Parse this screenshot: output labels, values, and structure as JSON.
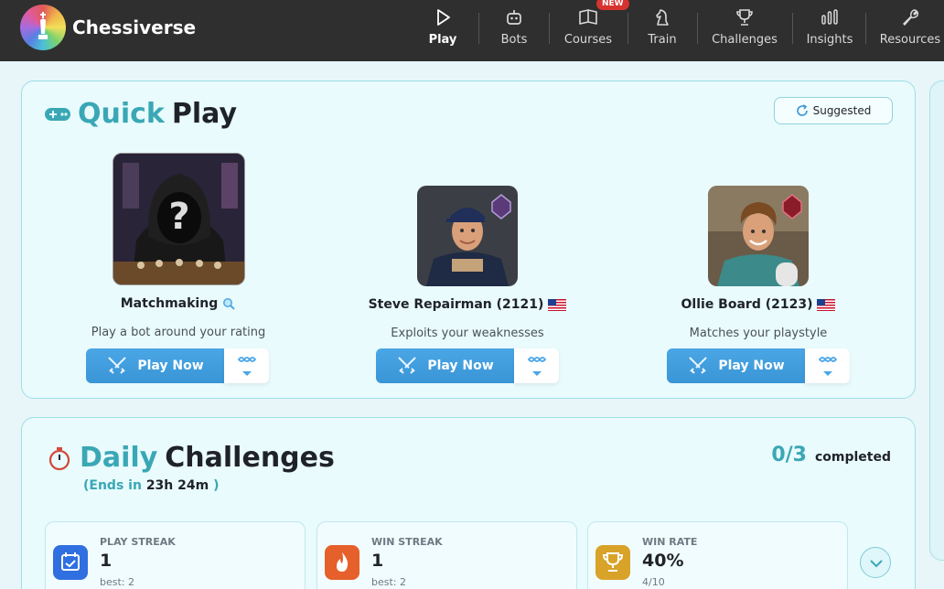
{
  "app": {
    "name": "Chessiverse"
  },
  "nav": {
    "items": [
      {
        "label": "Play",
        "icon": "play-icon",
        "active": true
      },
      {
        "label": "Bots",
        "icon": "robot-icon"
      },
      {
        "label": "Courses",
        "icon": "book-icon",
        "badge": "NEW"
      },
      {
        "label": "Train",
        "icon": "knight-icon"
      },
      {
        "label": "Challenges",
        "icon": "trophy-icon"
      },
      {
        "label": "Insights",
        "icon": "bar-chart-icon"
      },
      {
        "label": "Resources",
        "icon": "wrench-icon"
      }
    ]
  },
  "quick_play": {
    "title_accent": "Quick",
    "title_rest": "Play",
    "suggested_label": "Suggested",
    "bots": [
      {
        "name": "Matchmaking",
        "description": "Play a bot around your rating",
        "button": "Play Now"
      },
      {
        "name": "Steve Repairman (2121)",
        "description": "Exploits your weaknesses",
        "button": "Play Now"
      },
      {
        "name": "Ollie Board (2123)",
        "description": "Matches your playstyle",
        "button": "Play Now"
      }
    ]
  },
  "daily_challenges": {
    "title_accent": "Daily",
    "title_rest": "Challenges",
    "ends_label": "(Ends in",
    "ends_time": "23h 24m",
    "ends_close": ")",
    "completed_count": "0/3",
    "completed_label": "completed",
    "stats": [
      {
        "label": "PLAY STREAK",
        "value": "1",
        "best": "best: 2",
        "icon": "calendar-check-icon",
        "color": "#2f6fe0"
      },
      {
        "label": "WIN STREAK",
        "value": "1",
        "best": "best: 2",
        "icon": "flame-icon",
        "color": "#e5602a"
      },
      {
        "label": "WIN RATE",
        "value": "40%",
        "best": "4/10",
        "icon": "trophy-icon",
        "color": "#d9a228"
      }
    ]
  },
  "colors": {
    "accent": "#3aa7b5",
    "play_button": "#3a95d6",
    "nav_bg": "#2f2f2f"
  }
}
